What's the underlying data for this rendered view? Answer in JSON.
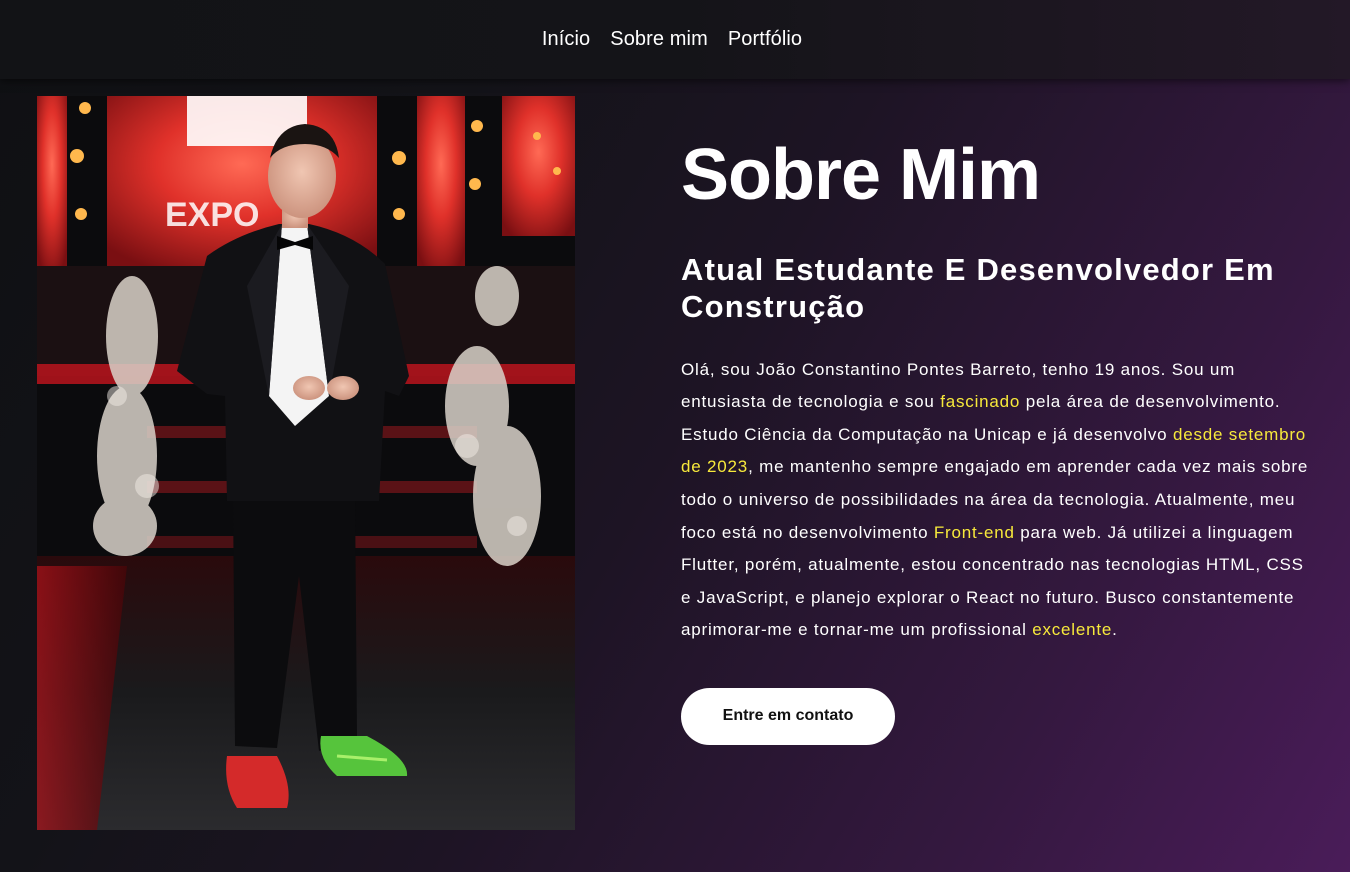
{
  "nav": {
    "links": [
      "Início",
      "Sobre mim",
      "Portfólio"
    ]
  },
  "photo": {
    "alt": "João Constantino Pontes Barreto de smoking em evento",
    "backdrop_text": "EXPO"
  },
  "about": {
    "title": "Sobre Mim",
    "subtitle": "Atual Estudante E Desenvolvedor Em Construção",
    "bio": {
      "p1": "Olá, sou João Constantino Pontes Barreto, tenho 19 anos. Sou um entusiasta de tecnologia e sou ",
      "h1": "fascinado",
      "p2": " pela área de desenvolvimento. Estudo Ciência da Computação na Unicap e já desenvolvo ",
      "h2": "desde setembro de 2023",
      "p3": ", me mantenho sempre engajado em aprender cada vez mais sobre todo o universo de possibilidades na área da tecnologia. Atualmente, meu foco está no desenvolvimento ",
      "h3": "Front-end",
      "p4": " para web. Já utilizei a linguagem Flutter, porém, atualmente, estou concentrado nas tecnologias HTML, CSS e JavaScript, e planejo explorar o React no futuro. Busco constantemente aprimorar-me e tornar-me um profissional ",
      "h4": "excelente",
      "p5": "."
    },
    "cta_label": "Entre em contato"
  },
  "colors": {
    "highlight": "#f7e93b",
    "button_bg": "#ffffff",
    "accent_purple": "#4a1c59"
  }
}
